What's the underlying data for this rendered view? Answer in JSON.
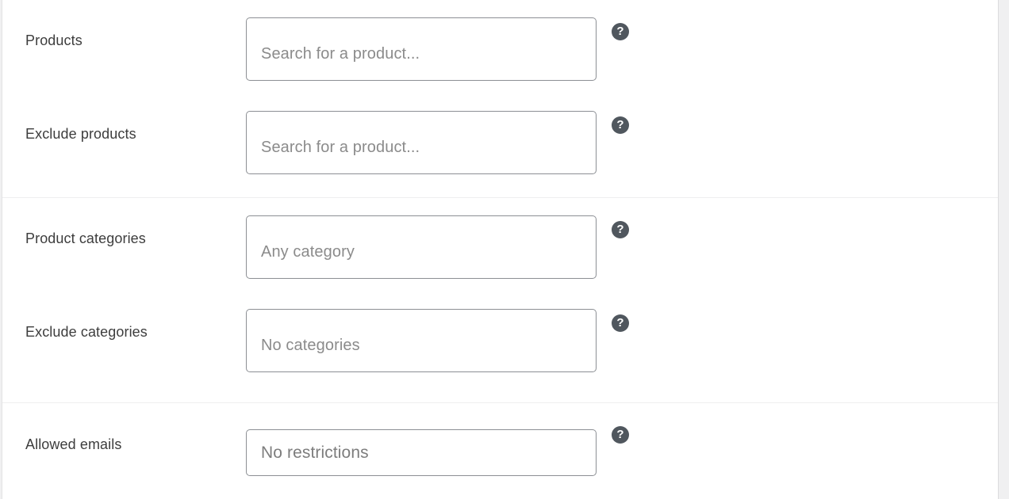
{
  "panel": {
    "background": "#ffffff",
    "gutter_color": "#f0f0f1",
    "border_color": "#dcdcde"
  },
  "help_icon": {
    "glyph": "?",
    "name": "help-tip-icon",
    "background": "#50575e",
    "foreground": "#ffffff"
  },
  "sections": [
    {
      "id": "usage-restriction-products",
      "rows": [
        {
          "id": "products",
          "label": "Products",
          "control_type": "multiselect",
          "placeholder": "Search for a product...",
          "value": ""
        },
        {
          "id": "exclude-products",
          "label": "Exclude products",
          "control_type": "multiselect",
          "placeholder": "Search for a product...",
          "value": ""
        }
      ]
    },
    {
      "id": "usage-restriction-categories",
      "rows": [
        {
          "id": "product-categories",
          "label": "Product categories",
          "control_type": "multiselect",
          "placeholder": "Any category",
          "value": ""
        },
        {
          "id": "exclude-categories",
          "label": "Exclude categories",
          "control_type": "multiselect",
          "placeholder": "No categories",
          "value": ""
        }
      ]
    },
    {
      "id": "usage-restriction-emails",
      "rows": [
        {
          "id": "allowed-emails",
          "label": "Allowed emails",
          "control_type": "text",
          "placeholder": "No restrictions",
          "value": ""
        }
      ]
    }
  ]
}
